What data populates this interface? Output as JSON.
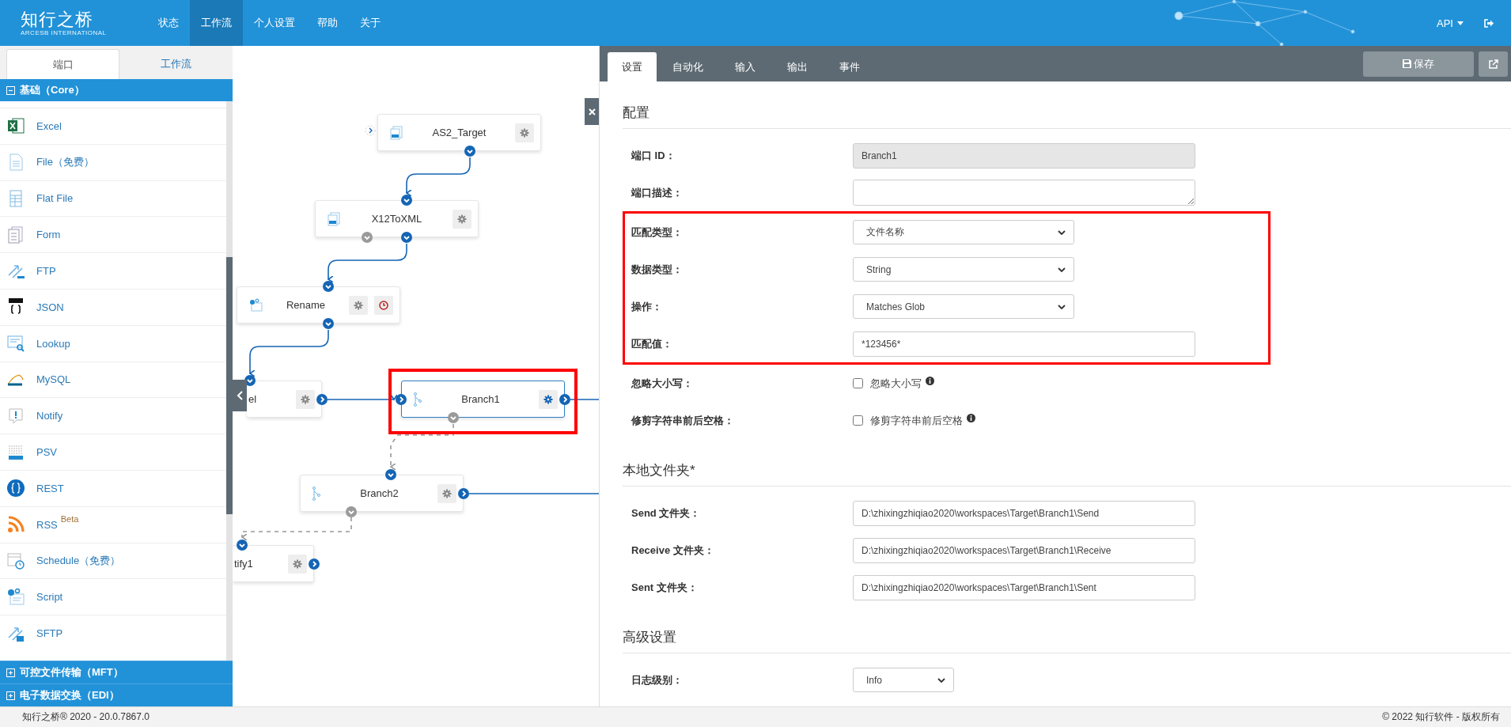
{
  "header": {
    "logo": "知行之桥",
    "logo_tagline": "ARCESB INTERNATIONAL",
    "nav": [
      {
        "label": "状态",
        "selected": false
      },
      {
        "label": "工作流",
        "selected": true
      },
      {
        "label": "个人设置",
        "selected": false
      },
      {
        "label": "帮助",
        "selected": false
      },
      {
        "label": "关于",
        "selected": false
      }
    ],
    "api_menu": "API"
  },
  "sidebar": {
    "tabs": [
      {
        "label": "端口",
        "selected": true
      },
      {
        "label": "工作流",
        "selected": false
      }
    ],
    "groups": [
      {
        "label": "基础（Core）",
        "expanded": true,
        "items": [
          {
            "label": "Excel",
            "kind": "excel"
          },
          {
            "label": "File（免费）",
            "kind": "file"
          },
          {
            "label": "Flat File",
            "kind": "flatfile"
          },
          {
            "label": "Form",
            "kind": "form"
          },
          {
            "label": "FTP",
            "kind": "ftp"
          },
          {
            "label": "JSON",
            "kind": "json"
          },
          {
            "label": "Lookup",
            "kind": "lookup"
          },
          {
            "label": "MySQL",
            "kind": "mysql"
          },
          {
            "label": "Notify",
            "kind": "notify"
          },
          {
            "label": "PSV",
            "kind": "psv"
          },
          {
            "label": "REST",
            "kind": "rest"
          },
          {
            "label": "RSS",
            "kind": "rss",
            "badge": "Beta"
          },
          {
            "label": "Schedule（免费）",
            "kind": "schedule"
          },
          {
            "label": "Script",
            "kind": "script"
          },
          {
            "label": "SFTP",
            "kind": "sftp"
          }
        ]
      },
      {
        "label": "可控文件传输（MFT）",
        "expanded": false
      },
      {
        "label": "电子数据交换（EDI）",
        "expanded": false
      }
    ]
  },
  "canvas": {
    "nodes": [
      {
        "label": "AS2_Target",
        "selected": false,
        "highlighted": false,
        "scheduled": false
      },
      {
        "label": "X12ToXML",
        "selected": false,
        "highlighted": false,
        "scheduled": false
      },
      {
        "label": "Rename",
        "selected": false,
        "highlighted": false,
        "scheduled": true
      },
      {
        "label": "el",
        "selected": false,
        "highlighted": false,
        "scheduled": false
      },
      {
        "label": "Branch1",
        "selected": true,
        "highlighted": true,
        "scheduled": false
      },
      {
        "label": "Branch2",
        "selected": false,
        "highlighted": false,
        "scheduled": false
      },
      {
        "label": "tify1",
        "selected": false,
        "highlighted": false,
        "scheduled": false
      }
    ]
  },
  "panel": {
    "tabs": [
      {
        "label": "设置",
        "selected": true
      },
      {
        "label": "自动化",
        "selected": false
      },
      {
        "label": "输入",
        "selected": false
      },
      {
        "label": "输出",
        "selected": false
      },
      {
        "label": "事件",
        "selected": false
      }
    ],
    "save_button": "保存",
    "sections": [
      {
        "title": "配置",
        "fields": [
          {
            "kind": "text",
            "label": "端口 ID：",
            "value": "Branch1",
            "disabled": true,
            "highlighted": false
          },
          {
            "kind": "textarea",
            "label": "端口描述：",
            "highlighted": false
          },
          {
            "kind": "select",
            "label": "匹配类型：",
            "value": "文件名称",
            "highlighted": true
          },
          {
            "kind": "select",
            "label": "数据类型：",
            "value": "String",
            "highlighted": true
          },
          {
            "kind": "select",
            "label": "操作：",
            "value": "Matches Glob",
            "highlighted": true
          },
          {
            "kind": "text",
            "label": "匹配值：",
            "value": "*123456*",
            "disabled": false,
            "highlighted": true
          },
          {
            "kind": "checkbox",
            "label": "忽略大小写：",
            "option": "忽略大小写",
            "checked": false,
            "highlighted": false
          },
          {
            "kind": "checkbox",
            "label": "修剪字符串前后空格：",
            "option": "修剪字符串前后空格",
            "checked": false,
            "highlighted": false
          }
        ]
      },
      {
        "title": "本地文件夹*",
        "fields": [
          {
            "kind": "text",
            "label": "Send 文件夹：",
            "value": "D:\\zhixingzhiqiao2020\\workspaces\\Target\\Branch1\\Send",
            "disabled": false,
            "highlighted": false
          },
          {
            "kind": "text",
            "label": "Receive 文件夹：",
            "value": "D:\\zhixingzhiqiao2020\\workspaces\\Target\\Branch1\\Receive",
            "disabled": false,
            "highlighted": false
          },
          {
            "kind": "text",
            "label": "Sent 文件夹：",
            "value": "D:\\zhixingzhiqiao2020\\workspaces\\Target\\Branch1\\Sent",
            "disabled": false,
            "highlighted": false
          }
        ]
      },
      {
        "title": "高级设置",
        "fields": [
          {
            "kind": "smallselect",
            "label": "日志级别：",
            "value": "Info",
            "highlighted": false
          }
        ]
      }
    ]
  },
  "footer": {
    "version": "知行之桥® 2020 - 20.0.7867.0",
    "copyright": "© 2022 知行软件 - 版权所有"
  }
}
